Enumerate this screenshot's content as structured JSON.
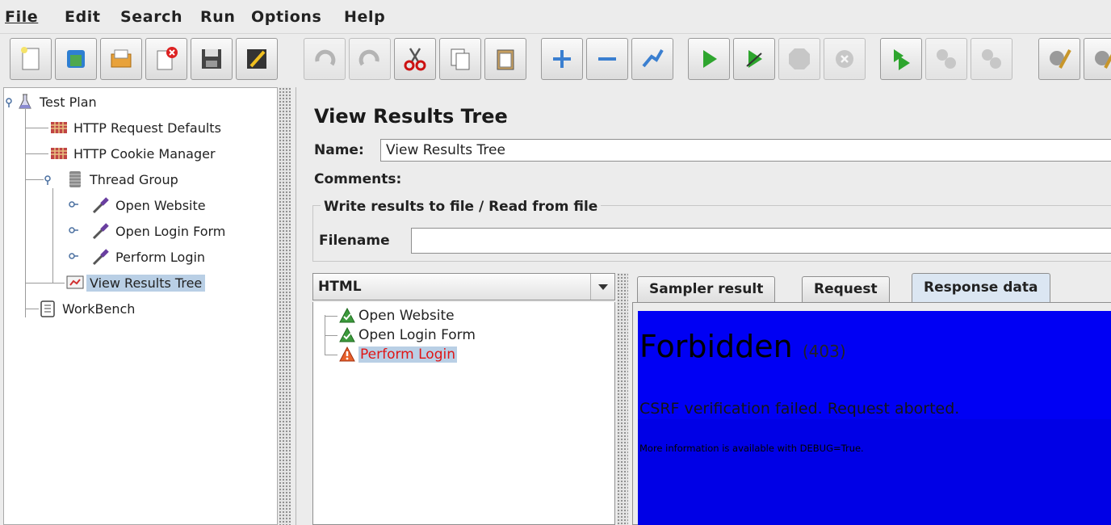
{
  "menu": [
    "File",
    "Edit",
    "Search",
    "Run",
    "Options",
    "Help"
  ],
  "toolbar": [
    {
      "name": "new-icon",
      "enabled": true
    },
    {
      "name": "templates-icon",
      "enabled": true
    },
    {
      "name": "open-icon",
      "enabled": true
    },
    {
      "name": "close-icon",
      "enabled": true
    },
    {
      "name": "save-icon",
      "enabled": true
    },
    {
      "name": "save-as-icon",
      "enabled": true
    },
    {
      "name": "undo-icon",
      "enabled": false
    },
    {
      "name": "redo-icon",
      "enabled": false
    },
    {
      "name": "cut-icon",
      "enabled": true
    },
    {
      "name": "copy-icon",
      "enabled": true
    },
    {
      "name": "paste-icon",
      "enabled": true
    },
    {
      "name": "expand-icon",
      "enabled": true
    },
    {
      "name": "collapse-icon",
      "enabled": true
    },
    {
      "name": "toggle-icon",
      "enabled": true
    },
    {
      "name": "start-icon",
      "enabled": true
    },
    {
      "name": "start-no-pauses-icon",
      "enabled": true
    },
    {
      "name": "stop-icon",
      "enabled": false
    },
    {
      "name": "shutdown-icon",
      "enabled": false
    },
    {
      "name": "remote-start-icon",
      "enabled": true
    },
    {
      "name": "remote-stop-icon",
      "enabled": false
    },
    {
      "name": "remote-shutdown-icon",
      "enabled": false
    },
    {
      "name": "clear-icon",
      "enabled": true
    },
    {
      "name": "clear-all-icon",
      "enabled": true
    }
  ],
  "tree": {
    "items": [
      {
        "label": "Test Plan",
        "icon": "flask-icon"
      },
      {
        "label": "HTTP Request Defaults",
        "icon": "config-icon"
      },
      {
        "label": "HTTP Cookie Manager",
        "icon": "config-icon"
      },
      {
        "label": "Thread Group",
        "icon": "spool-icon"
      },
      {
        "label": "Open Website",
        "icon": "pipette-icon"
      },
      {
        "label": "Open Login Form",
        "icon": "pipette-icon"
      },
      {
        "label": "Perform Login",
        "icon": "pipette-icon"
      },
      {
        "label": "View Results Tree",
        "icon": "monitor-icon"
      },
      {
        "label": "WorkBench",
        "icon": "clipboard-icon"
      }
    ]
  },
  "panel": {
    "title": "View Results Tree",
    "name_label": "Name:",
    "name_value": "View Results Tree",
    "comments_label": "Comments:",
    "group_title": "Write results to file / Read from file",
    "filename_label": "Filename",
    "filename_value": ""
  },
  "results": {
    "renderer": "HTML",
    "items": [
      {
        "label": "Open Website",
        "status": "success"
      },
      {
        "label": "Open Login Form",
        "status": "success"
      },
      {
        "label": "Perform Login",
        "status": "error"
      }
    ]
  },
  "tabs": [
    {
      "label": "Sampler result",
      "active": false
    },
    {
      "label": "Request",
      "active": false
    },
    {
      "label": "Response data",
      "active": true
    }
  ],
  "response": {
    "title": "Forbidden",
    "code": "(403)",
    "message": "CSRF verification failed. Request aborted.",
    "info": "More information is available with DEBUG=True.",
    "bg_color": "#0000f4"
  },
  "colors": {
    "selection": "#b9cfe5",
    "error_text": "#e01515"
  }
}
